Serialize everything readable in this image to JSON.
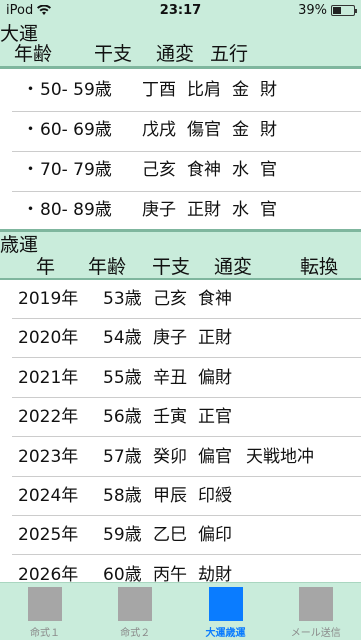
{
  "status": {
    "carrier": "iPod",
    "time": "23:17",
    "battery": "39%",
    "battery_level": 0.39
  },
  "taiun": {
    "title": "大運",
    "headers": {
      "age": "年齢",
      "kanshi": "干支",
      "tsuhen": "通変",
      "gogyo": "五行"
    },
    "rows": [
      {
        "bullet": "・",
        "age": "50- 59歳",
        "kanshi": "丁酉",
        "tsuhen": "比肩",
        "gogyo": "金",
        "extra": "財"
      },
      {
        "bullet": "・",
        "age": "60- 69歳",
        "kanshi": "戊戌",
        "tsuhen": "傷官",
        "gogyo": "金",
        "extra": "財"
      },
      {
        "bullet": "・",
        "age": "70- 79歳",
        "kanshi": "己亥",
        "tsuhen": "食神",
        "gogyo": "水",
        "extra": "官"
      },
      {
        "bullet": "・",
        "age": "80- 89歳",
        "kanshi": "庚子",
        "tsuhen": "正財",
        "gogyo": "水",
        "extra": "官"
      }
    ]
  },
  "saiun": {
    "title": "歳運",
    "headers": {
      "year": "年",
      "age": "年齢",
      "kanshi": "干支",
      "tsuhen": "通変",
      "tenkan": "転換"
    },
    "rows": [
      {
        "year": "2019年",
        "age": "53歳",
        "kanshi": "己亥",
        "tsuhen": "食神",
        "tenkan": ""
      },
      {
        "year": "2020年",
        "age": "54歳",
        "kanshi": "庚子",
        "tsuhen": "正財",
        "tenkan": ""
      },
      {
        "year": "2021年",
        "age": "55歳",
        "kanshi": "辛丑",
        "tsuhen": "偏財",
        "tenkan": ""
      },
      {
        "year": "2022年",
        "age": "56歳",
        "kanshi": "壬寅",
        "tsuhen": "正官",
        "tenkan": ""
      },
      {
        "year": "2023年",
        "age": "57歳",
        "kanshi": "癸卯",
        "tsuhen": "偏官",
        "tenkan": "天戦地冲"
      },
      {
        "year": "2024年",
        "age": "58歳",
        "kanshi": "甲辰",
        "tsuhen": "印綬",
        "tenkan": ""
      },
      {
        "year": "2025年",
        "age": "59歳",
        "kanshi": "乙巳",
        "tsuhen": "偏印",
        "tenkan": ""
      },
      {
        "year": "2026年",
        "age": "60歳",
        "kanshi": "丙午",
        "tsuhen": "劫財",
        "tenkan": ""
      }
    ]
  },
  "tabs": [
    {
      "label": "命式１",
      "icon": "placeholder-square-icon",
      "active": false
    },
    {
      "label": "命式２",
      "icon": "placeholder-square-icon",
      "active": false
    },
    {
      "label": "大運歳運",
      "icon": "placeholder-square-icon",
      "active": true
    },
    {
      "label": "メール送信",
      "icon": "placeholder-square-icon",
      "active": false
    }
  ],
  "colors": {
    "header_bg": "#c9ecdb",
    "rule": "#7fb69e",
    "active_tab": "#0a7cff",
    "inactive_tab": "#a6a6a6"
  }
}
